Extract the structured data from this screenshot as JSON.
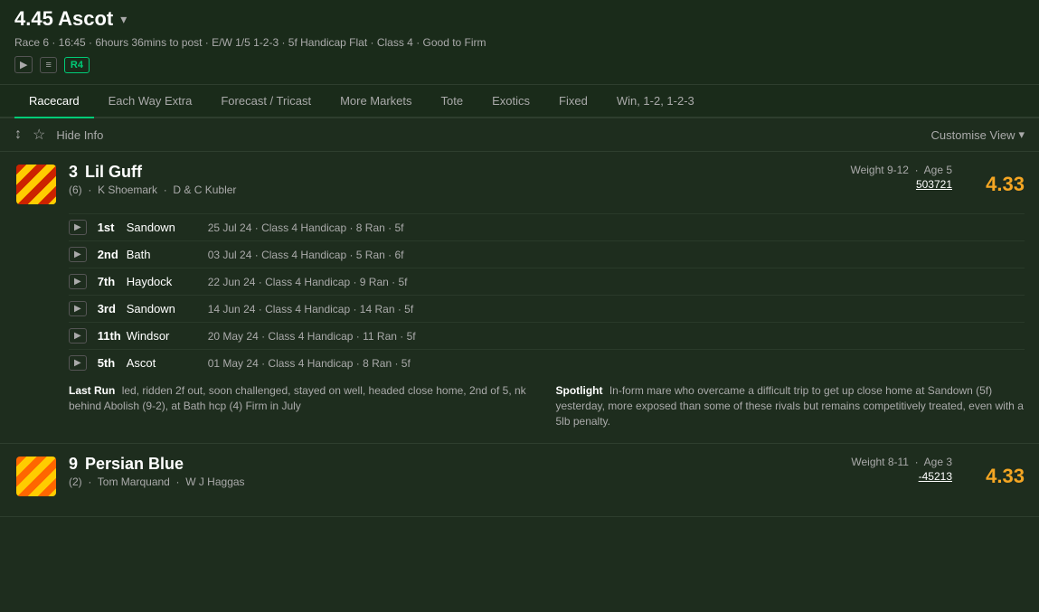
{
  "header": {
    "title": "4.45 Ascot",
    "chevron": "▾",
    "race_info": "Race 6 · 16:45 · 6hours 36mins to post · E/W 1/5 1-2-3 · 5f Handicap Flat · Class 4 · Good to Firm",
    "badges": [
      "▶",
      "≡",
      "R4"
    ]
  },
  "tabs": [
    {
      "label": "Racecard",
      "active": true
    },
    {
      "label": "Each Way Extra",
      "active": false
    },
    {
      "label": "Forecast / Tricast",
      "active": false
    },
    {
      "label": "More Markets",
      "active": false
    },
    {
      "label": "Tote",
      "active": false
    },
    {
      "label": "Exotics",
      "active": false
    },
    {
      "label": "Fixed",
      "active": false
    },
    {
      "label": "Win, 1-2, 1-2-3",
      "active": false
    }
  ],
  "toolbar": {
    "sort_icon": "↕",
    "star_icon": "☆",
    "hide_info_label": "Hide Info",
    "customise_view_label": "Customise View",
    "customise_chevron": "▾"
  },
  "horses": [
    {
      "number": "3",
      "name": "Lil Guff",
      "draw": "(6)",
      "trainer": "K Shoemark",
      "owner": "D & C Kubler",
      "weight": "Weight 9-12",
      "age": "Age 5",
      "form": "503721",
      "odds": "4.33",
      "history": [
        {
          "position": "1st",
          "venue": "Sandown",
          "details": "25 Jul 24 · Class 4 Handicap · 8 Ran · 5f"
        },
        {
          "position": "2nd",
          "venue": "Bath",
          "details": "03 Jul 24 · Class 4 Handicap · 5 Ran · 6f"
        },
        {
          "position": "7th",
          "venue": "Haydock",
          "details": "22 Jun 24 · Class 4 Handicap · 9 Ran · 5f"
        },
        {
          "position": "3rd",
          "venue": "Sandown",
          "details": "14 Jun 24 · Class 4 Handicap · 14 Ran · 5f"
        },
        {
          "position": "11th",
          "venue": "Windsor",
          "details": "20 May 24 · Class 4 Handicap · 11 Ran · 5f"
        },
        {
          "position": "5th",
          "venue": "Ascot",
          "details": "01 May 24 · Class 4 Handicap · 8 Ran · 5f"
        }
      ],
      "last_run": "led, ridden 2f out, soon challenged, stayed on well, headed close home, 2nd of 5, nk behind Abolish (9-2), at Bath hcp (4) Firm in July",
      "spotlight": "In-form mare who overcame a difficult trip to get up close home at Sandown (5f) yesterday, more exposed than some of these rivals but remains competitively treated, even with a 5lb penalty."
    },
    {
      "number": "9",
      "name": "Persian Blue",
      "draw": "(2)",
      "trainer": "Tom Marquand",
      "owner": "W J Haggas",
      "weight": "Weight 8-11",
      "age": "Age 3",
      "form": "-45213",
      "odds": "4.33",
      "history": [],
      "last_run": "",
      "spotlight": ""
    }
  ],
  "labels": {
    "last_run": "Last Run",
    "spotlight": "Spotlight",
    "play_icon": "▶",
    "sort_label": "↕",
    "star_label": "☆"
  }
}
